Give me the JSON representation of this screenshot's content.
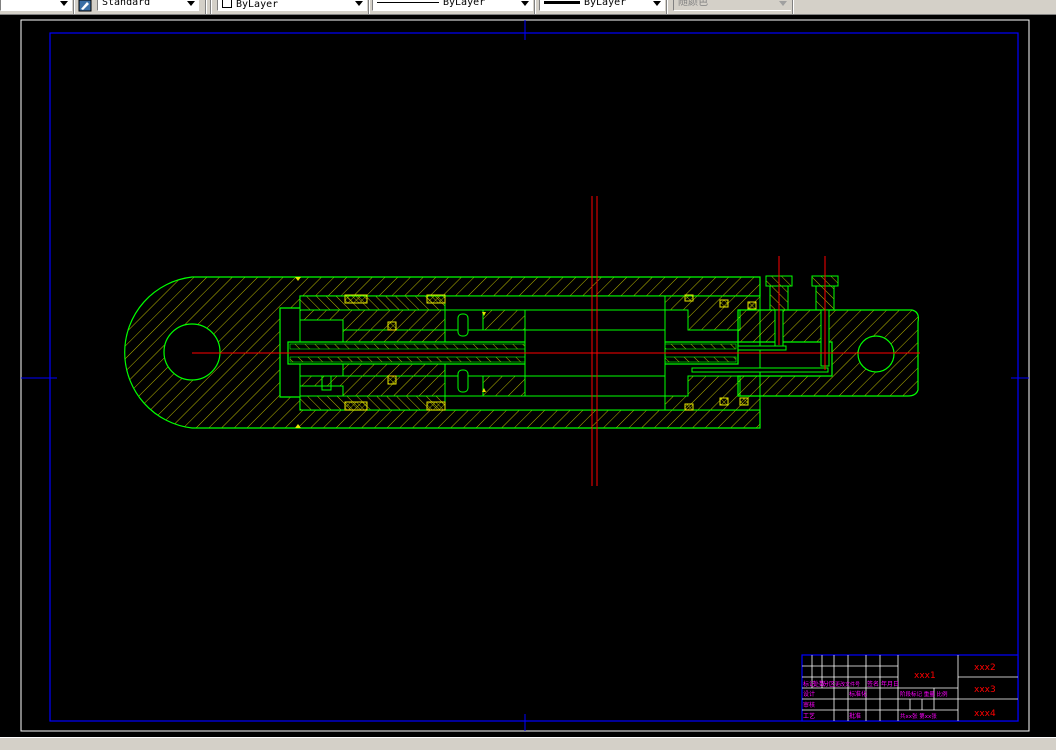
{
  "toolbar": {
    "text_style": "Standard",
    "layer": "ByLayer",
    "linetype": "ByLayer",
    "lineweight": "ByLayer",
    "plot_style": "随颜色"
  },
  "title_block": {
    "drawing_name": "xxx1",
    "code_a": "xxx2",
    "code_b": "xxx3",
    "code_c": "xxx4",
    "row_labels": [
      "标记",
      "处数",
      "分区",
      "更改文件号",
      "签名",
      "年月日"
    ],
    "design": "设计",
    "standard": "标准化",
    "review": "审核",
    "craft": "工艺",
    "approve": "批准",
    "stage_label": "阶段标记  重量  比例",
    "scale_text": "共xx张  第xx张"
  },
  "colors": {
    "outline": "#00ff00",
    "hatch": "#e6e600",
    "center": "#ff0000",
    "frame": "#0000ff",
    "title_text": "#ff00ff",
    "code_text": "#ff0000"
  }
}
